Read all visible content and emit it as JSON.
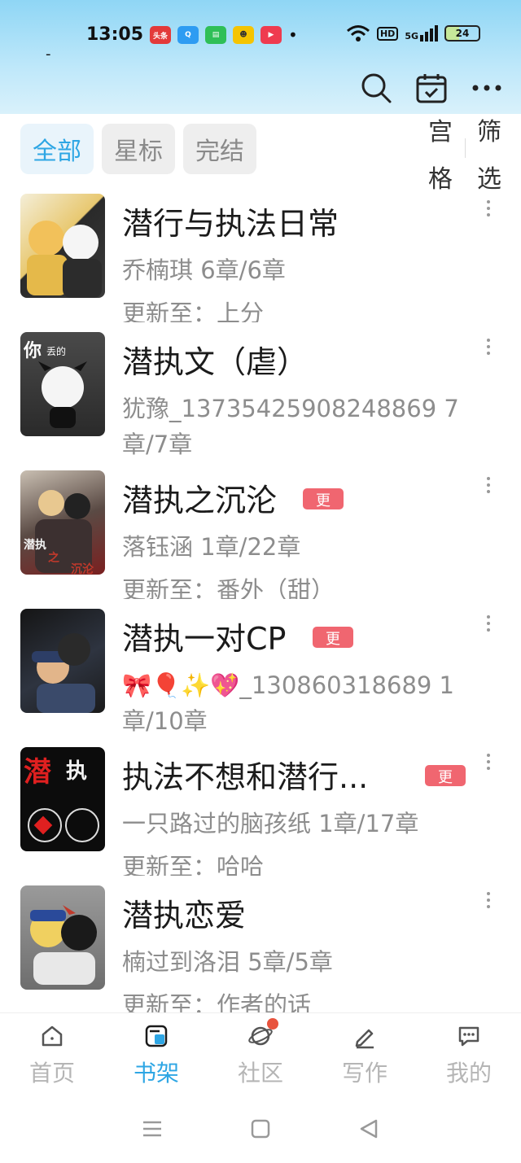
{
  "status_bar": {
    "time": "13:05",
    "app_badges": [
      {
        "label": "头条",
        "color": "#e33a3a"
      },
      {
        "label": "Q",
        "color": "#2e9cf2"
      },
      {
        "label": "▤",
        "color": "#2fbf57"
      },
      {
        "label": "☻",
        "color": "#f5c400"
      },
      {
        "label": "▶",
        "color": "#ef3b4f"
      }
    ],
    "dot": "•",
    "hd": "HD",
    "network": "5G",
    "battery": "24"
  },
  "header": {
    "dash": "-",
    "icons": [
      "search-icon",
      "calendar-check-icon",
      "more-horizontal-icon"
    ]
  },
  "filters": {
    "chips": [
      {
        "label": "全部",
        "active": true
      },
      {
        "label": "星标",
        "active": false
      },
      {
        "label": "完结",
        "active": false
      }
    ],
    "grid_label": "宫格",
    "filter_label": "筛选"
  },
  "books": [
    {
      "title": "潜行与执法日常",
      "meta": "乔楠琪  6章/6章",
      "update": "更新至：上分",
      "badge": "",
      "cover_colors": [
        "#e8c870",
        "#2a2a2a"
      ]
    },
    {
      "title": "潜执文（虐）",
      "meta": "犹豫_13735425908248869  7章/7章",
      "update": "",
      "badge": "",
      "cover_colors": [
        "#3a3a3a",
        "#f2f2f2"
      ]
    },
    {
      "title": "潜执之沉沦",
      "meta": "落钰涵  1章/22章",
      "update": "更新至：番外（甜）",
      "badge": "更",
      "cover_colors": [
        "#5a4a44",
        "#a82828"
      ]
    },
    {
      "title": "潜执一对CP",
      "meta": "🎀🎈✨💖_130860318689  1章/10章",
      "update": "",
      "badge": "更",
      "cover_colors": [
        "#1c1c1c",
        "#4a5a7a"
      ]
    },
    {
      "title": "执法不想和潜行...",
      "meta": "一只路过的脑孩纸  1章/17章",
      "update": "更新至：哈哈",
      "badge": "更",
      "cover_colors": [
        "#0c0c0c",
        "#e02020"
      ]
    },
    {
      "title": "潜执恋爱",
      "meta": "楠过到洛泪  5章/5章",
      "update": "更新至：作者的话",
      "badge": "",
      "cover_colors": [
        "#8a8a8a",
        "#f0d060"
      ]
    }
  ],
  "bottom_nav": [
    {
      "label": "首页",
      "icon": "home-icon",
      "active": false
    },
    {
      "label": "书架",
      "icon": "bookshelf-icon",
      "active": true
    },
    {
      "label": "社区",
      "icon": "planet-icon",
      "active": false,
      "dot": true
    },
    {
      "label": "写作",
      "icon": "pen-icon",
      "active": false
    },
    {
      "label": "我的",
      "icon": "message-icon",
      "active": false
    }
  ],
  "colors": {
    "accent": "#2ea6e4",
    "badge": "#f06670",
    "header_top": "#8fd6f5"
  }
}
